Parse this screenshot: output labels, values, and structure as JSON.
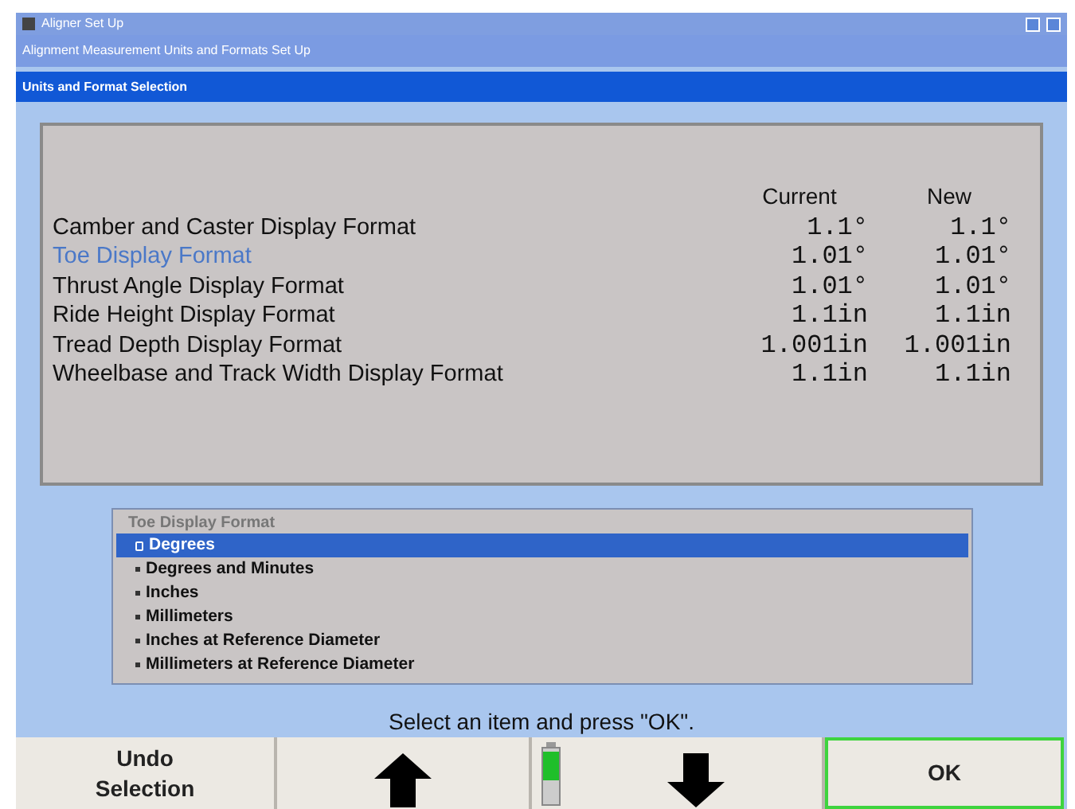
{
  "window": {
    "title": "Aligner Set Up"
  },
  "subtitle": "Alignment Measurement Units and Formats Set Up",
  "section_title": "Units and Format Selection",
  "table": {
    "columns": [
      "Current",
      "New"
    ],
    "rows": [
      {
        "label": "Camber and Caster Display Format",
        "current": "1.1°",
        "new": "1.1°",
        "selected": false
      },
      {
        "label": "Toe Display Format",
        "current": "1.01°",
        "new": "1.01°",
        "selected": true
      },
      {
        "label": "Thrust Angle Display Format",
        "current": "1.01°",
        "new": "1.01°",
        "selected": false
      },
      {
        "label": "Ride Height Display Format",
        "current": "1.1in",
        "new": "1.1in",
        "selected": false
      },
      {
        "label": "Tread Depth Display Format",
        "current": "1.001in",
        "new": "1.001in",
        "selected": false
      },
      {
        "label": "Wheelbase and Track Width Display Format",
        "current": "1.1in",
        "new": "1.1in",
        "selected": false
      }
    ]
  },
  "options": {
    "title": "Toe Display Format",
    "items": [
      {
        "label": "Degrees",
        "selected": true
      },
      {
        "label": "Degrees and Minutes",
        "selected": false
      },
      {
        "label": "Inches",
        "selected": false
      },
      {
        "label": "Millimeters",
        "selected": false
      },
      {
        "label": "Inches at Reference Diameter",
        "selected": false
      },
      {
        "label": "Millimeters at Reference Diameter",
        "selected": false
      }
    ]
  },
  "status": "Select an item and press \"OK\".",
  "buttons": [
    {
      "kind": "text",
      "label": "Undo Selection"
    },
    {
      "kind": "up"
    },
    {
      "kind": "indicator"
    },
    {
      "kind": "down"
    },
    {
      "kind": "text",
      "label": "OK",
      "selected": true
    }
  ]
}
